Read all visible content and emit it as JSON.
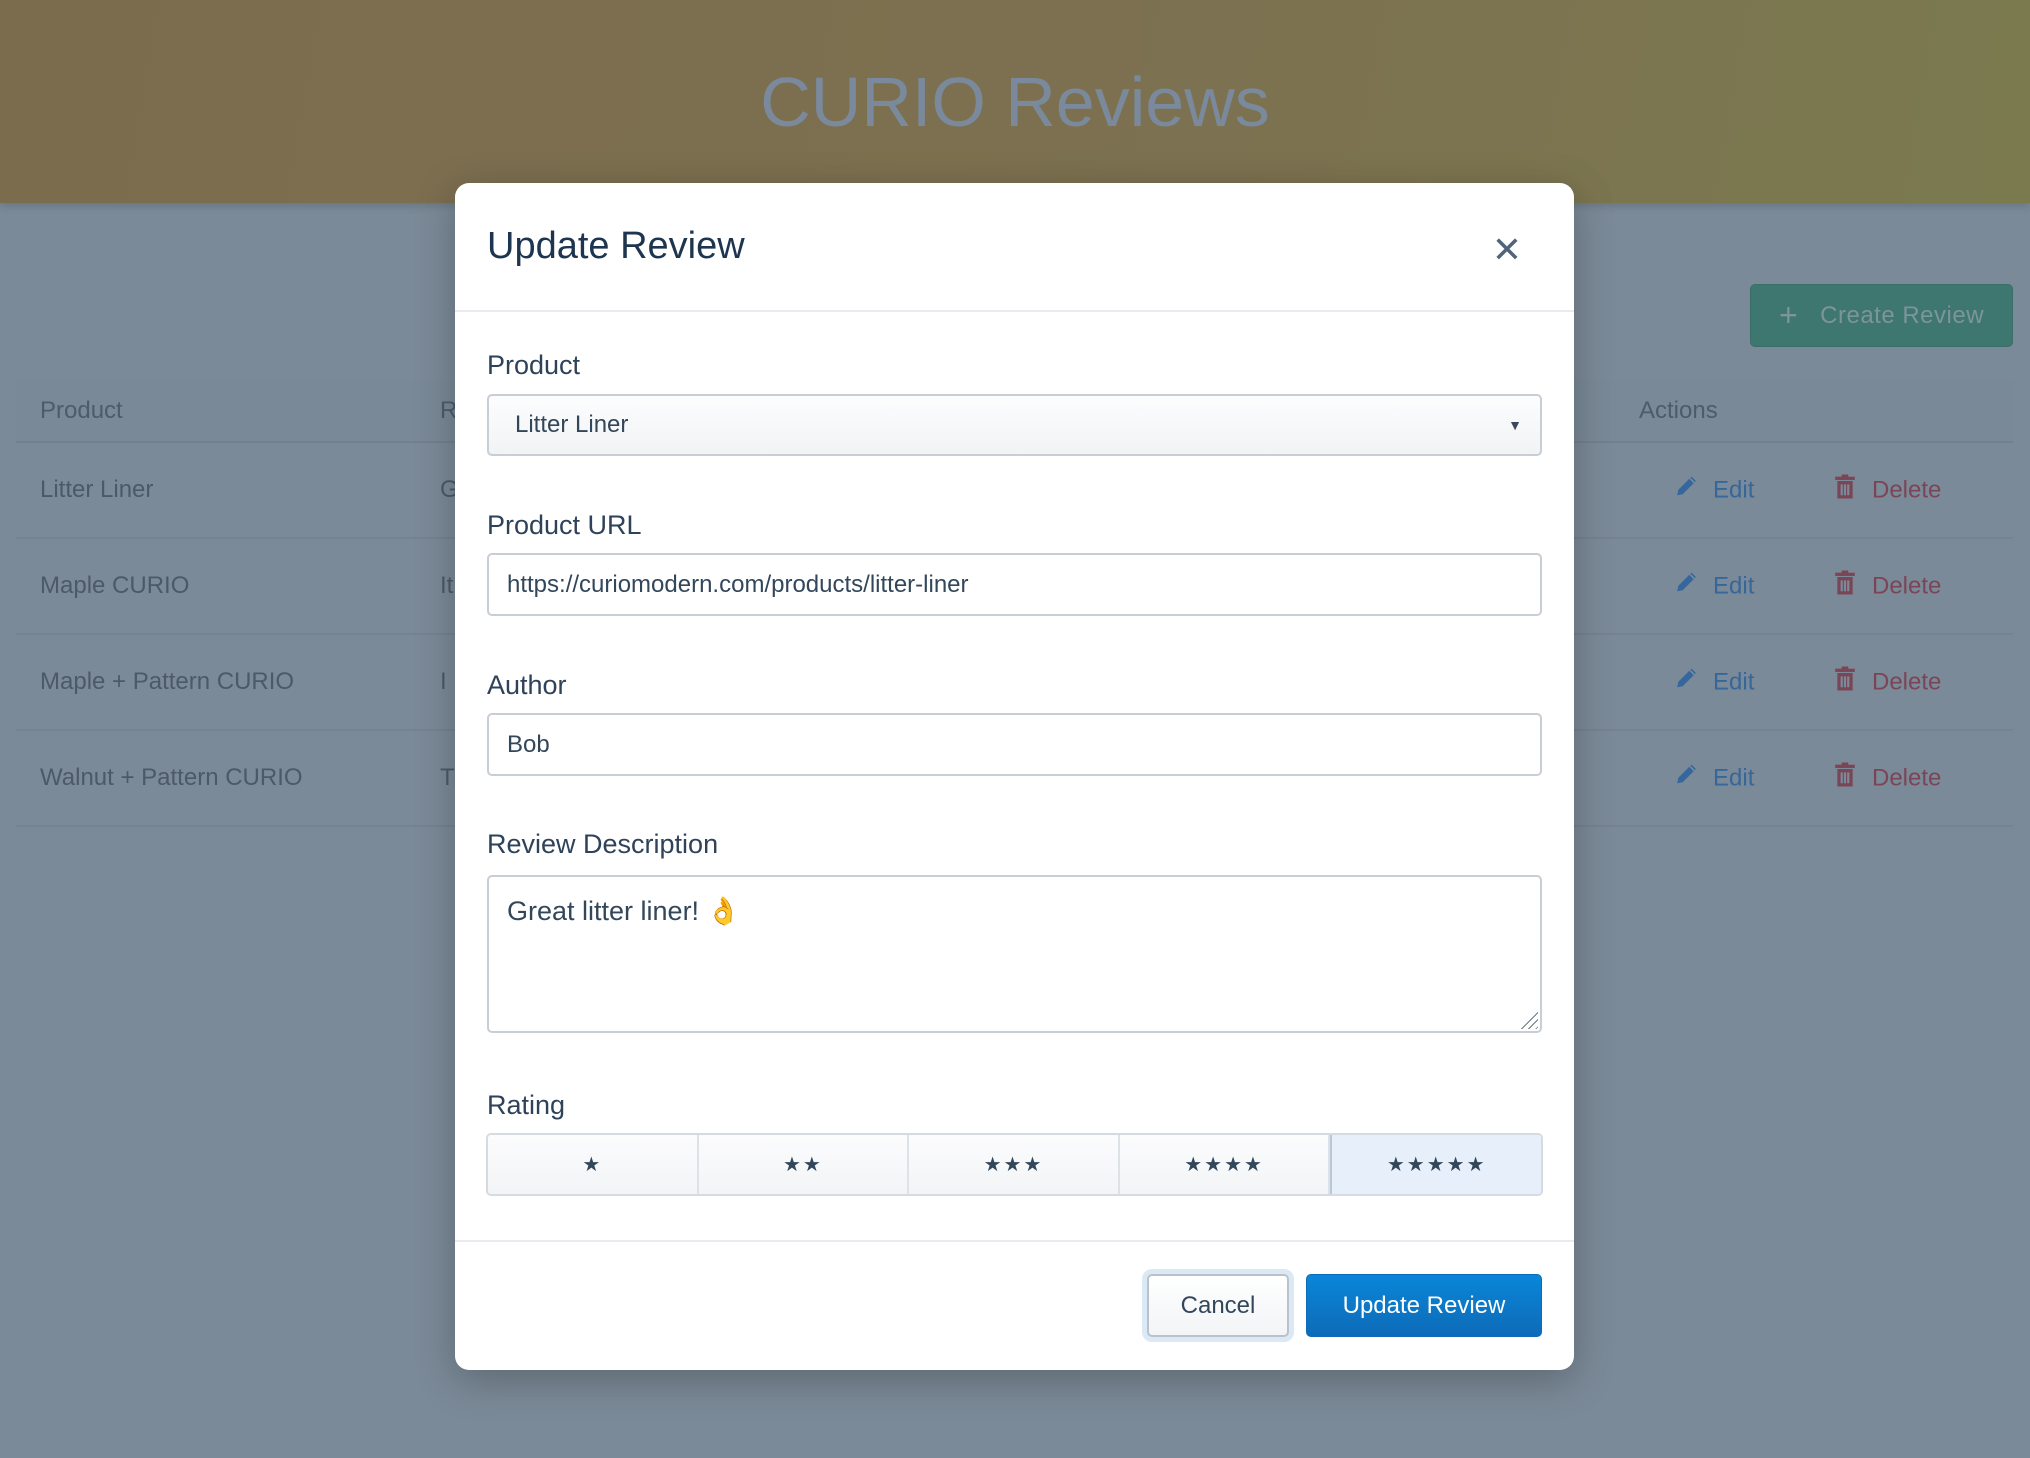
{
  "page": {
    "title": "CURIO Reviews",
    "create_label": "Create Review"
  },
  "table": {
    "headers": [
      "Product",
      "R",
      "Actions"
    ],
    "rows": [
      {
        "product": "Litter Liner",
        "review": "G"
      },
      {
        "product": "Maple CURIO",
        "review": "It"
      },
      {
        "product": "Maple + Pattern CURIO",
        "review": "I"
      },
      {
        "product": "Walnut + Pattern CURIO",
        "review": "T"
      }
    ],
    "edit_label": "Edit",
    "delete_label": "Delete"
  },
  "modal": {
    "title": "Update Review",
    "product_label": "Product",
    "product_value": "Litter Liner",
    "url_label": "Product URL",
    "url_value": "https://curiomodern.com/products/litter-liner",
    "author_label": "Author",
    "author_value": "Bob",
    "desc_label": "Review Description",
    "desc_value": "Great litter liner! 👌",
    "rating_label": "Rating",
    "rating_options": [
      "★",
      "★★",
      "★★★",
      "★★★★",
      "★★★★★"
    ],
    "rating_selected": 5,
    "cancel_label": "Cancel",
    "submit_label": "Update Review"
  },
  "colors": {
    "primary": "#0a7bd0",
    "edit": "#36679b",
    "delete": "#7a4556",
    "create": "#3e7670"
  }
}
